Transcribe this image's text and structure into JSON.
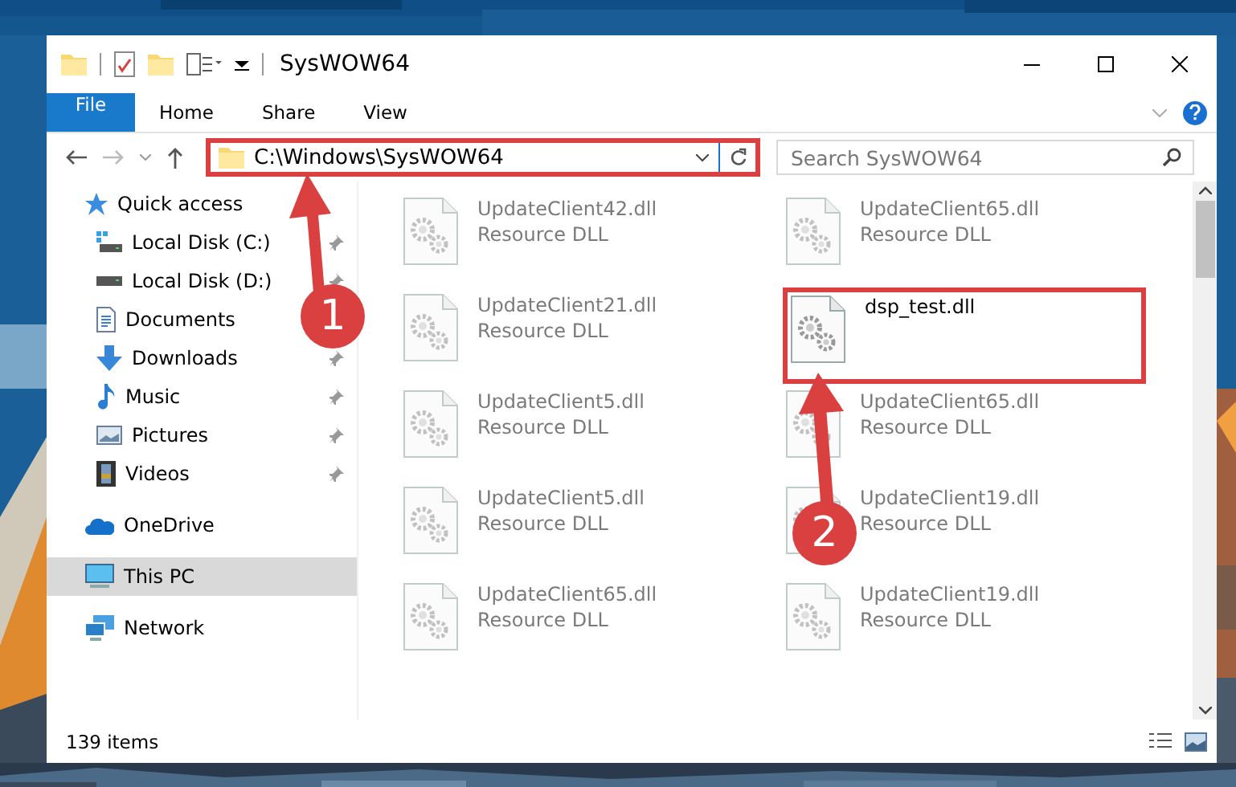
{
  "window": {
    "title": "SysWOW64"
  },
  "ribbon": {
    "tabs": [
      {
        "label": "File",
        "kind": "file-menu"
      },
      {
        "label": "Home",
        "kind": "tab"
      },
      {
        "label": "Share",
        "kind": "tab"
      },
      {
        "label": "View",
        "kind": "tab"
      }
    ]
  },
  "address_bar": {
    "path": "C:\\Windows\\SysWOW64",
    "highlighted": true
  },
  "search": {
    "placeholder": "Search SysWOW64"
  },
  "sidebar": {
    "items": [
      {
        "label": "Quick access",
        "kind": "star",
        "selected": false,
        "children": [
          {
            "label": "Local Disk (C:)",
            "kind": "drive-windows",
            "pinned": true
          },
          {
            "label": "Local Disk (D:)",
            "kind": "drive",
            "pinned": true
          },
          {
            "label": "Documents",
            "kind": "documents"
          },
          {
            "label": "Downloads",
            "kind": "downloads",
            "pinned": true
          },
          {
            "label": "Music",
            "kind": "music",
            "pinned": true
          },
          {
            "label": "Pictures",
            "kind": "pictures",
            "pinned": true
          },
          {
            "label": "Videos",
            "kind": "videos",
            "pinned": true
          }
        ]
      },
      {
        "label": "OneDrive",
        "kind": "cloud",
        "selected": false
      },
      {
        "label": "This PC",
        "kind": "computer",
        "selected": true
      },
      {
        "label": "Network",
        "kind": "network",
        "selected": false
      }
    ]
  },
  "files": [
    {
      "name": "UpdateClient42.dll",
      "type": "Resource DLL",
      "blurred": true,
      "highlighted": false
    },
    {
      "name": "UpdateClient65.dll",
      "type": "Resource DLL",
      "blurred": true,
      "highlighted": false
    },
    {
      "name": "UpdateClient21.dll",
      "type": "Resource DLL",
      "blurred": true,
      "highlighted": false
    },
    {
      "name": "dsp_test.dll",
      "blurred": false,
      "highlighted": true
    },
    {
      "name": "UpdateClient5.dll",
      "type": "Resource DLL",
      "blurred": true,
      "highlighted": false
    },
    {
      "name": "UpdateClient65.dll",
      "type": "Resource DLL",
      "blurred": true,
      "highlighted": false
    },
    {
      "name": "UpdateClient5.dll",
      "type": "Resource DLL",
      "blurred": true,
      "highlighted": false
    },
    {
      "name": "UpdateClient19.dll",
      "type": "Resource DLL",
      "blurred": true,
      "highlighted": false
    },
    {
      "name": "UpdateClient65.dll",
      "type": "Resource DLL",
      "blurred": true,
      "highlighted": false
    },
    {
      "name": "UpdateClient19.dll",
      "type": "Resource DLL",
      "blurred": true,
      "highlighted": false
    }
  ],
  "status_bar": {
    "item_count": "139 items"
  },
  "callouts": [
    {
      "number": "1"
    },
    {
      "number": "2"
    }
  ]
}
